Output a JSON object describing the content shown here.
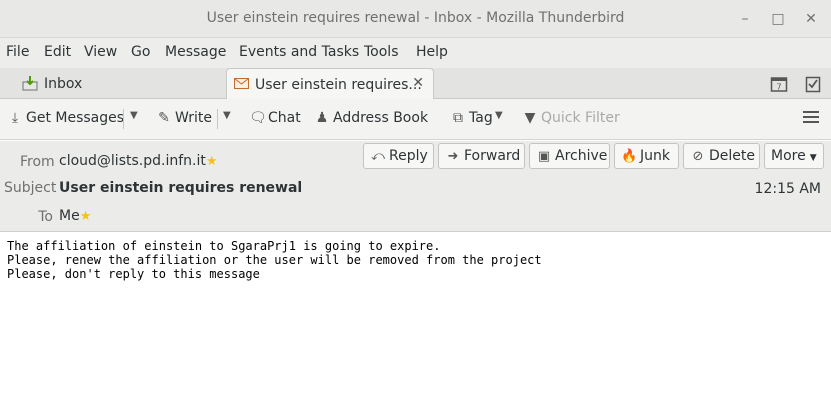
{
  "window": {
    "title": "User einstein requires renewal - Inbox - Mozilla Thunderbird",
    "minimize_icon": "minimize-icon",
    "maximize_icon": "maximize-icon",
    "close_icon": "close-icon"
  },
  "menubar": {
    "items": [
      "File",
      "Edit",
      "View",
      "Go",
      "Message",
      "Events and Tasks",
      "Tools",
      "Help"
    ]
  },
  "tabs": [
    {
      "label": "Inbox",
      "icon": "inbox-icon"
    },
    {
      "label": "User einstein requires...",
      "icon": "envelope-icon"
    }
  ],
  "toolbar": {
    "get_messages": "Get Messages",
    "write": "Write",
    "chat": "Chat",
    "address_book": "Address Book",
    "tag": "Tag",
    "quick_filter": "Quick Filter"
  },
  "header": {
    "from_label": "From",
    "from_value": "cloud@lists.pd.infn.it",
    "subject_label": "Subject",
    "subject_value": "User einstein requires renewal",
    "to_label": "To",
    "to_value": "Me",
    "time": "12:15 AM",
    "buttons": {
      "reply": "Reply",
      "forward": "Forward",
      "archive": "Archive",
      "junk": "Junk",
      "delete": "Delete",
      "more": "More"
    }
  },
  "body": {
    "lines": [
      "The affiliation of einstein to SgaraPrj1 is going to expire.",
      "Please, renew the affiliation or the user will be removed from the project",
      "Please, don't reply to this message"
    ]
  },
  "colors": {
    "star": "#f5c211",
    "titlebar": "#e8e8e7",
    "header_bg": "#ebebea"
  }
}
